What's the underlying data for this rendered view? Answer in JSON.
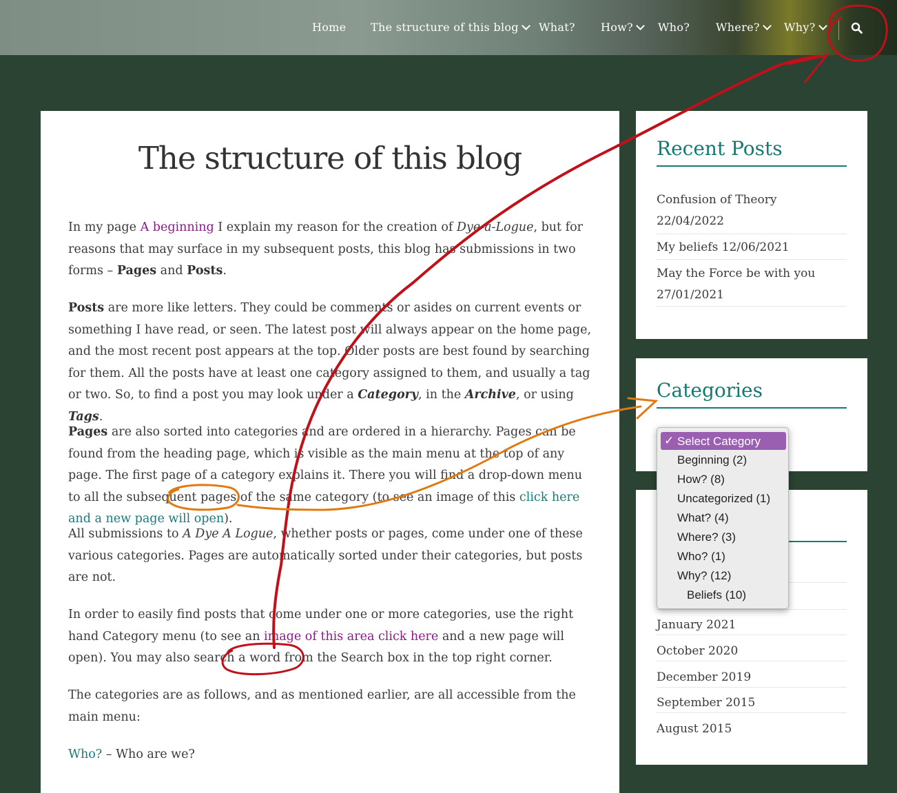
{
  "nav": {
    "items": [
      {
        "label": "Home",
        "dropdown": false
      },
      {
        "label": "The structure of this blog",
        "dropdown": true
      },
      {
        "label": "What?",
        "dropdown": false
      },
      {
        "label": "How?",
        "dropdown": true
      },
      {
        "label": "Who?",
        "dropdown": false
      },
      {
        "label": "Where?",
        "dropdown": true
      },
      {
        "label": "Why?",
        "dropdown": true
      }
    ],
    "search_icon": "search-icon"
  },
  "article": {
    "title": "The structure of this blog",
    "p1": {
      "t1": "In my page ",
      "link1": "A beginning",
      "t2": " I explain my reason for the creation of ",
      "em1": "Dye-a-Logue",
      "t3": ", but for reasons that may surface in my subsequent posts, this blog has submissions in two forms – ",
      "b1": "Pages",
      "t4": " and ",
      "b2": "Posts",
      "t5": "."
    },
    "p2": {
      "b1": "Posts",
      "t1": " are more like letters. They could be comments or asides on current events or something I have read, or seen. The latest post will always appear on the home page, and the most recent post appears at the top. Older posts are best found by searching for them. All the posts have at least one category assigned to them, and usually a tag or two. So, to find a post you may look under a ",
      "bi1": "Category",
      "t2": ", in the ",
      "bi2": "Archive",
      "t3": ", or using ",
      "bi3": "Tags",
      "t4": "."
    },
    "p3": {
      "b1": "Pages",
      "t1": " are also sorted into categories and are ordered in a hierarchy. Pages can be found from the heading page, which is visible as the main menu at the top of any page. The first page of a category explains it. There you will find a drop-down menu to all the subsequent pages of the same category (to see an image of this ",
      "link1": "click here and a new page will open",
      "t2": ")."
    },
    "p4": {
      "t1": "All submissions to ",
      "em1": "A Dye A Logue",
      "t2": ", whether posts or pages, come under one of these various categories. Pages are automatically sorted under their categories, but posts are not."
    },
    "p5": {
      "t1": "In order to easily find posts that come under one or more categories, use the right hand Category menu (to see an ",
      "link1": "image of this area click here",
      "t2": " and a new page will open). You may also search a word from the Search box in the top right corner."
    },
    "p6": "The categories are as follows, and as mentioned earlier, are all accessible from the main menu:",
    "p7": {
      "link1": "Who?",
      "t1": " –  Who are we?"
    }
  },
  "sidebar": {
    "recent_title": "Recent Posts",
    "recent": [
      "Confusion of Theory 22/04/2022",
      "My beliefs 12/06/2021",
      "May the Force be with you 27/01/2021"
    ],
    "categories_title": "Categories",
    "archives": [
      "January 2021",
      "October 2020",
      "December 2019",
      "September 2015",
      "August 2015"
    ]
  },
  "category_dropdown": {
    "selected": "Select Category",
    "checkmark": "✓",
    "options": [
      {
        "label": "Beginning  (2)",
        "indent": 0
      },
      {
        "label": "How?  (8)",
        "indent": 0
      },
      {
        "label": "Uncategorized  (1)",
        "indent": 0
      },
      {
        "label": "What?  (4)",
        "indent": 0
      },
      {
        "label": "Where?  (3)",
        "indent": 0
      },
      {
        "label": "Who?  (1)",
        "indent": 0
      },
      {
        "label": "Why?  (12)",
        "indent": 0
      },
      {
        "label": "Beliefs  (10)",
        "indent": 1
      }
    ]
  },
  "colors": {
    "background": "#2a4332",
    "accent_teal": "#137a70",
    "link_purple": "#8a1a8a",
    "annotation_red": "#c0101a",
    "annotation_orange": "#e07a10",
    "dropdown_highlight": "#9a5fb0"
  }
}
